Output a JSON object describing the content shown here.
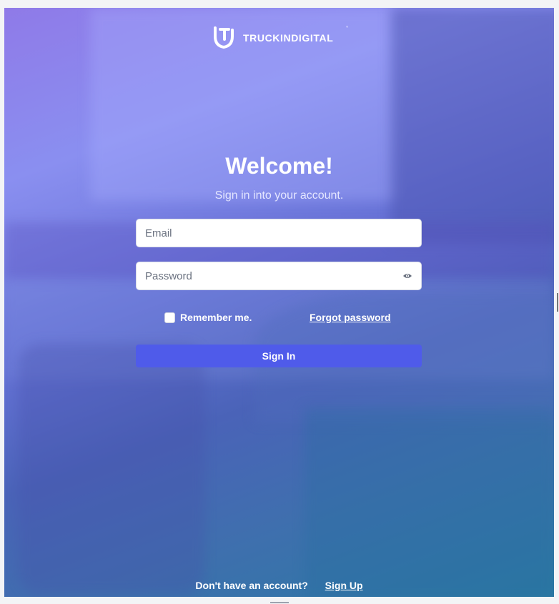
{
  "brand": {
    "name": "TRUCKINDIGITAL",
    "mark": "°"
  },
  "welcome": {
    "title": "Welcome!",
    "subtitle": "Sign in into your account."
  },
  "form": {
    "email_placeholder": "Email",
    "password_placeholder": "Password",
    "remember_label": "Remember me.",
    "forgot_label": "Forgot password",
    "signin_label": "Sign In"
  },
  "footer": {
    "prompt": "Don't have an account?",
    "signup_label": "Sign Up"
  },
  "colors": {
    "accent": "#4f5bea",
    "text_on_bg": "#ffffff"
  }
}
